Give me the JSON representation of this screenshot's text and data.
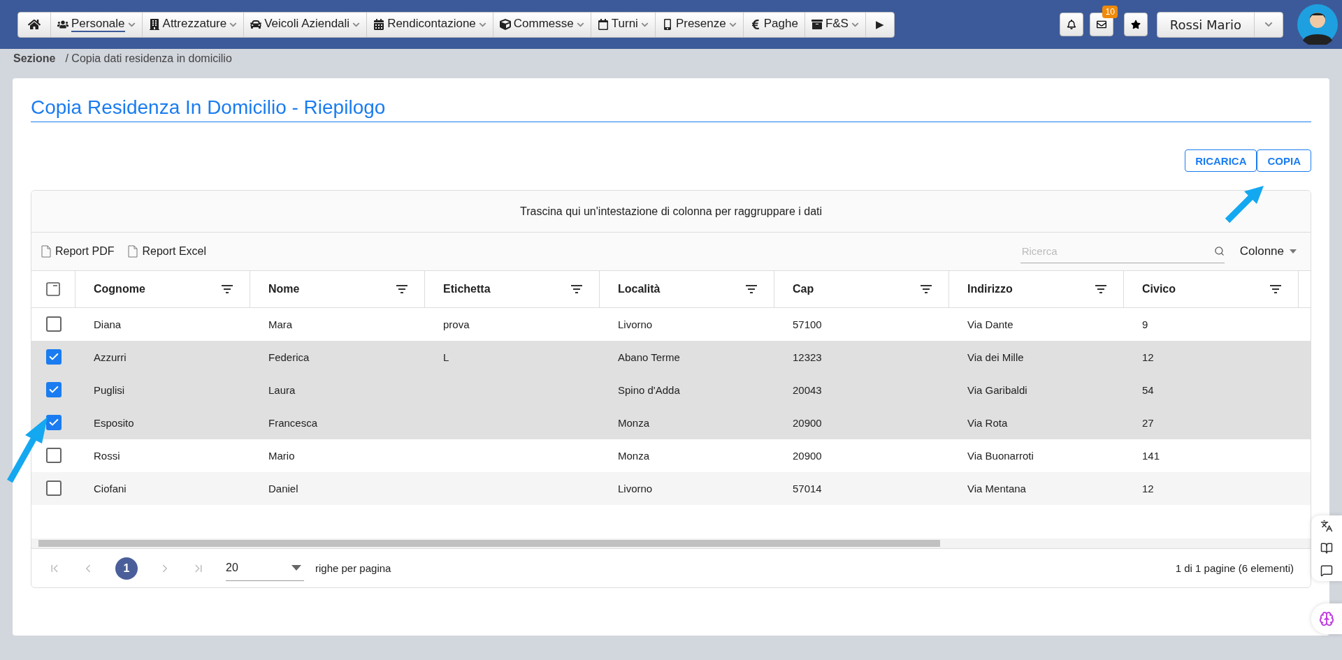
{
  "nav": {
    "items": [
      {
        "label": "Personale",
        "has_menu": true,
        "selected": true
      },
      {
        "label": "Attrezzature",
        "has_menu": true,
        "selected": false
      },
      {
        "label": "Veicoli Aziendali",
        "has_menu": true,
        "selected": false
      },
      {
        "label": "Rendicontazione",
        "has_menu": true,
        "selected": false
      },
      {
        "label": "Commesse",
        "has_menu": true,
        "selected": false
      },
      {
        "label": "Turni",
        "has_menu": true,
        "selected": false
      },
      {
        "label": "Presenze",
        "has_menu": true,
        "selected": false
      },
      {
        "label": "Paghe",
        "has_menu": false,
        "selected": false
      },
      {
        "label": "F&S",
        "has_menu": true,
        "selected": false
      }
    ],
    "more": "▶",
    "mail_badge": "10",
    "user": "Rossi Mario"
  },
  "breadcrumb": {
    "section": "Sezione",
    "path": "/ Copia dati residenza in domicilio"
  },
  "title": "Copia Residenza In Domicilio - Riepilogo",
  "actions": [
    "RICARICA",
    "COPIA"
  ],
  "grid": {
    "group_hint": "Trascina qui un'intestazione di colonna per raggruppare i dati",
    "toolbar": [
      "Report PDF",
      "Report Excel"
    ],
    "select_all_indeterminate": true,
    "search": {
      "placeholder": "Ricerca"
    },
    "columns_menu": "Colonne",
    "columns": [
      "Cognome",
      "Nome",
      "Etichetta",
      "Località",
      "Cap",
      "Indirizzo",
      "Civico"
    ],
    "rows": [
      {
        "selected": false,
        "cells": [
          "Diana",
          "Mara",
          "prova",
          "Livorno",
          "57100",
          "Via Dante",
          "9"
        ]
      },
      {
        "selected": true,
        "cells": [
          "Azzurri",
          "Federica",
          "L",
          "Abano Terme",
          "12323",
          "Via dei Mille",
          "12"
        ]
      },
      {
        "selected": true,
        "cells": [
          "Puglisi",
          "Laura",
          "",
          "Spino d'Adda",
          "20043",
          "Via Garibaldi",
          "54"
        ]
      },
      {
        "selected": true,
        "cells": [
          "Esposito",
          "Francesca",
          "",
          "Monza",
          "20900",
          "Via Rota",
          "27"
        ]
      },
      {
        "selected": false,
        "cells": [
          "Rossi",
          "Mario",
          "",
          "Monza",
          "20900",
          "Via Buonarroti",
          "141"
        ]
      },
      {
        "selected": false,
        "cells": [
          "Ciofani",
          "Daniel",
          "",
          "Livorno",
          "57014",
          "Via Mentana",
          "12"
        ]
      }
    ],
    "pager": {
      "page": "1",
      "page_size": "20",
      "size_label": "righe per pagina",
      "info": "1 di 1 pagine (6 elementi)"
    }
  }
}
